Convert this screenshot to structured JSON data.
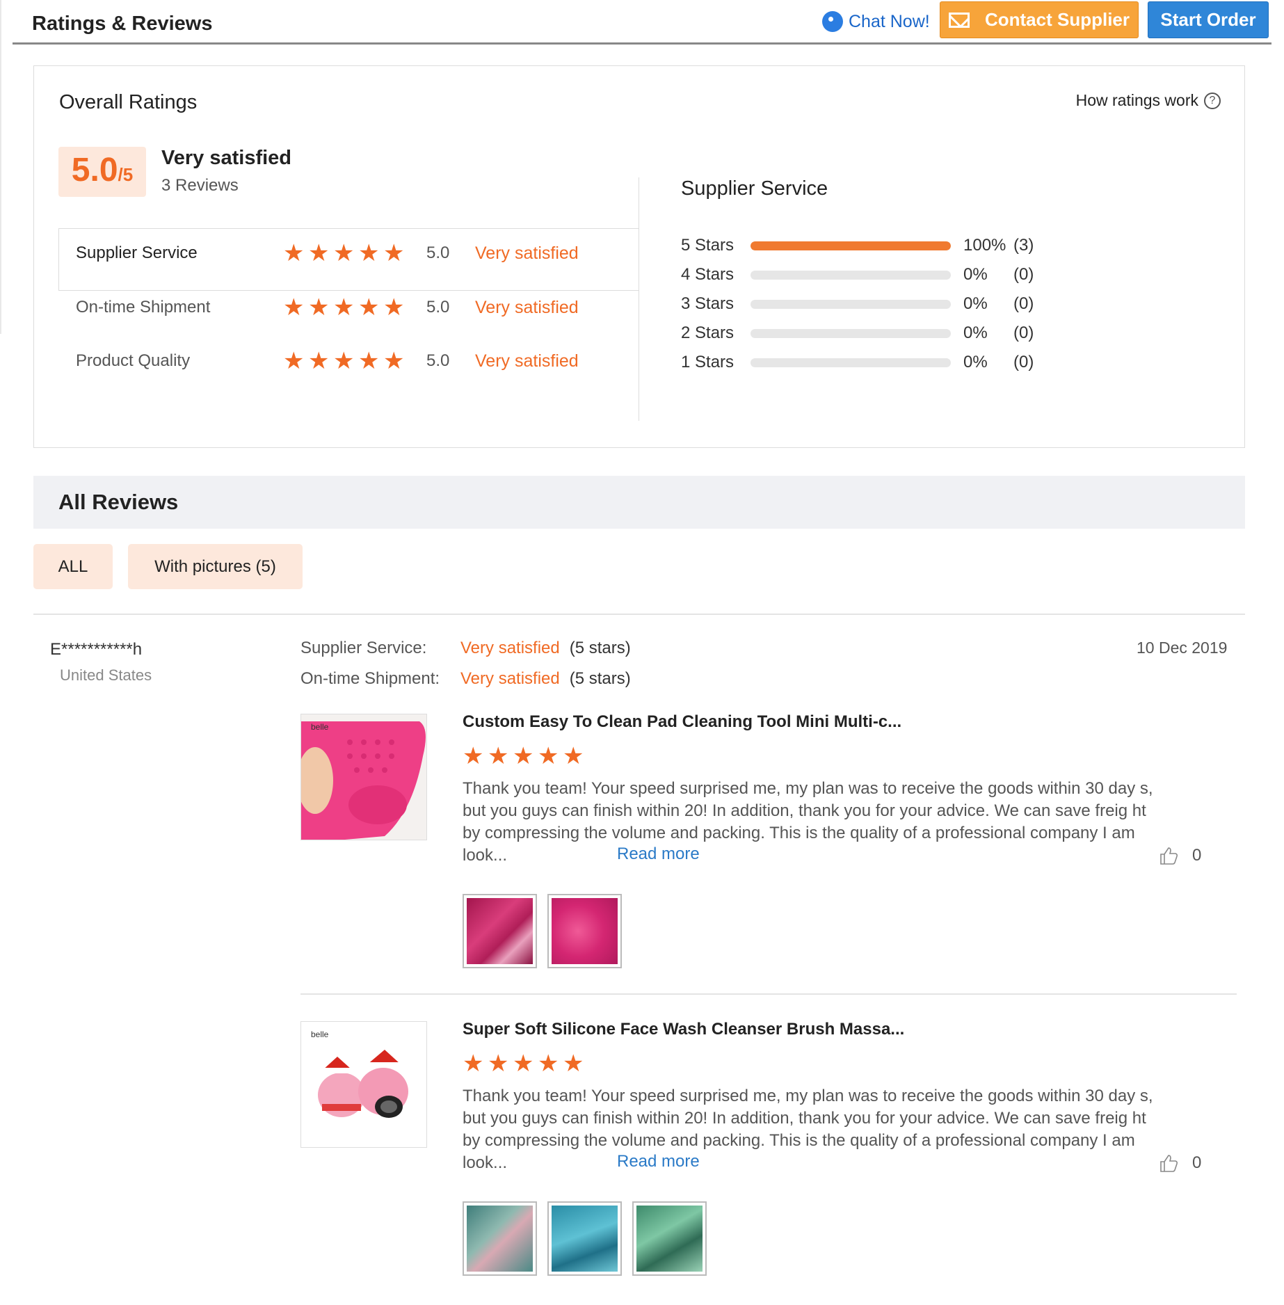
{
  "header": {
    "title": "Ratings & Reviews",
    "chat_label": "Chat Now!",
    "contact_label": "Contact Supplier",
    "start_label": "Start Order"
  },
  "overall": {
    "title": "Overall Ratings",
    "how_label": "How ratings work",
    "score": "5.0",
    "score_max": "/5",
    "summary_label": "Very satisfied",
    "review_count": "3 Reviews",
    "categories": [
      {
        "label": "Supplier Service",
        "stars": 5,
        "score": "5.0",
        "text": "Very satisfied"
      },
      {
        "label": "On-time Shipment",
        "stars": 5,
        "score": "5.0",
        "text": "Very satisfied"
      },
      {
        "label": "Product Quality",
        "stars": 5,
        "score": "5.0",
        "text": "Very satisfied"
      }
    ],
    "distribution_title": "Supplier Service",
    "distribution": [
      {
        "label": "5  Stars",
        "fraction": 1.0,
        "pct": "100%",
        "count": "(3)"
      },
      {
        "label": "4  Stars",
        "fraction": 0.0,
        "pct": "0%",
        "count": "(0)"
      },
      {
        "label": "3  Stars",
        "fraction": 0.0,
        "pct": "0%",
        "count": "(0)"
      },
      {
        "label": "2  Stars",
        "fraction": 0.0,
        "pct": "0%",
        "count": "(0)"
      },
      {
        "label": "1  Stars",
        "fraction": 0.0,
        "pct": "0%",
        "count": "(0)"
      }
    ]
  },
  "all_reviews": {
    "title": "All Reviews",
    "filters": [
      "ALL",
      "With pictures (5)"
    ]
  },
  "review": {
    "reviewer": "E***********h",
    "country": "United States",
    "date": "10 Dec 2019",
    "meta": [
      {
        "label": "Supplier Service:",
        "value": "Very satisfied",
        "stars": "(5 stars)"
      },
      {
        "label": "On-time Shipment:",
        "value": "Very satisfied",
        "stars": "(5 stars)"
      }
    ],
    "items": [
      {
        "title": "Custom Easy To Clean Pad Cleaning Tool Mini Multi-c...",
        "stars": 5,
        "image_brand": "belle",
        "text": "Thank you team!  Your speed surprised me, my plan was to receive the goods within 30 day s, but you guys can finish within 20! In addition, thank you for your advice. We can save freig ht by compressing the volume and packing. This is the quality of a professional company I am look...",
        "read_more": "Read more",
        "likes": "0",
        "thumb_count": 2
      },
      {
        "title": "Super Soft Silicone Face Wash Cleanser Brush Massa...",
        "stars": 5,
        "image_brand": "belle",
        "text": "Thank you team!  Your speed surprised me, my plan was to receive the goods within 30 day s, but you guys can finish within 20! In addition, thank you for your advice. We can save freig ht by compressing the volume and packing. This is the quality of a professional company I am look...",
        "read_more": "Read more",
        "likes": "0",
        "thumb_count": 3
      }
    ]
  },
  "colors": {
    "accent": "#f06a24",
    "contact_button": "#f7a43a",
    "start_button": "#2f86d8",
    "link": "#2a7ac7"
  }
}
